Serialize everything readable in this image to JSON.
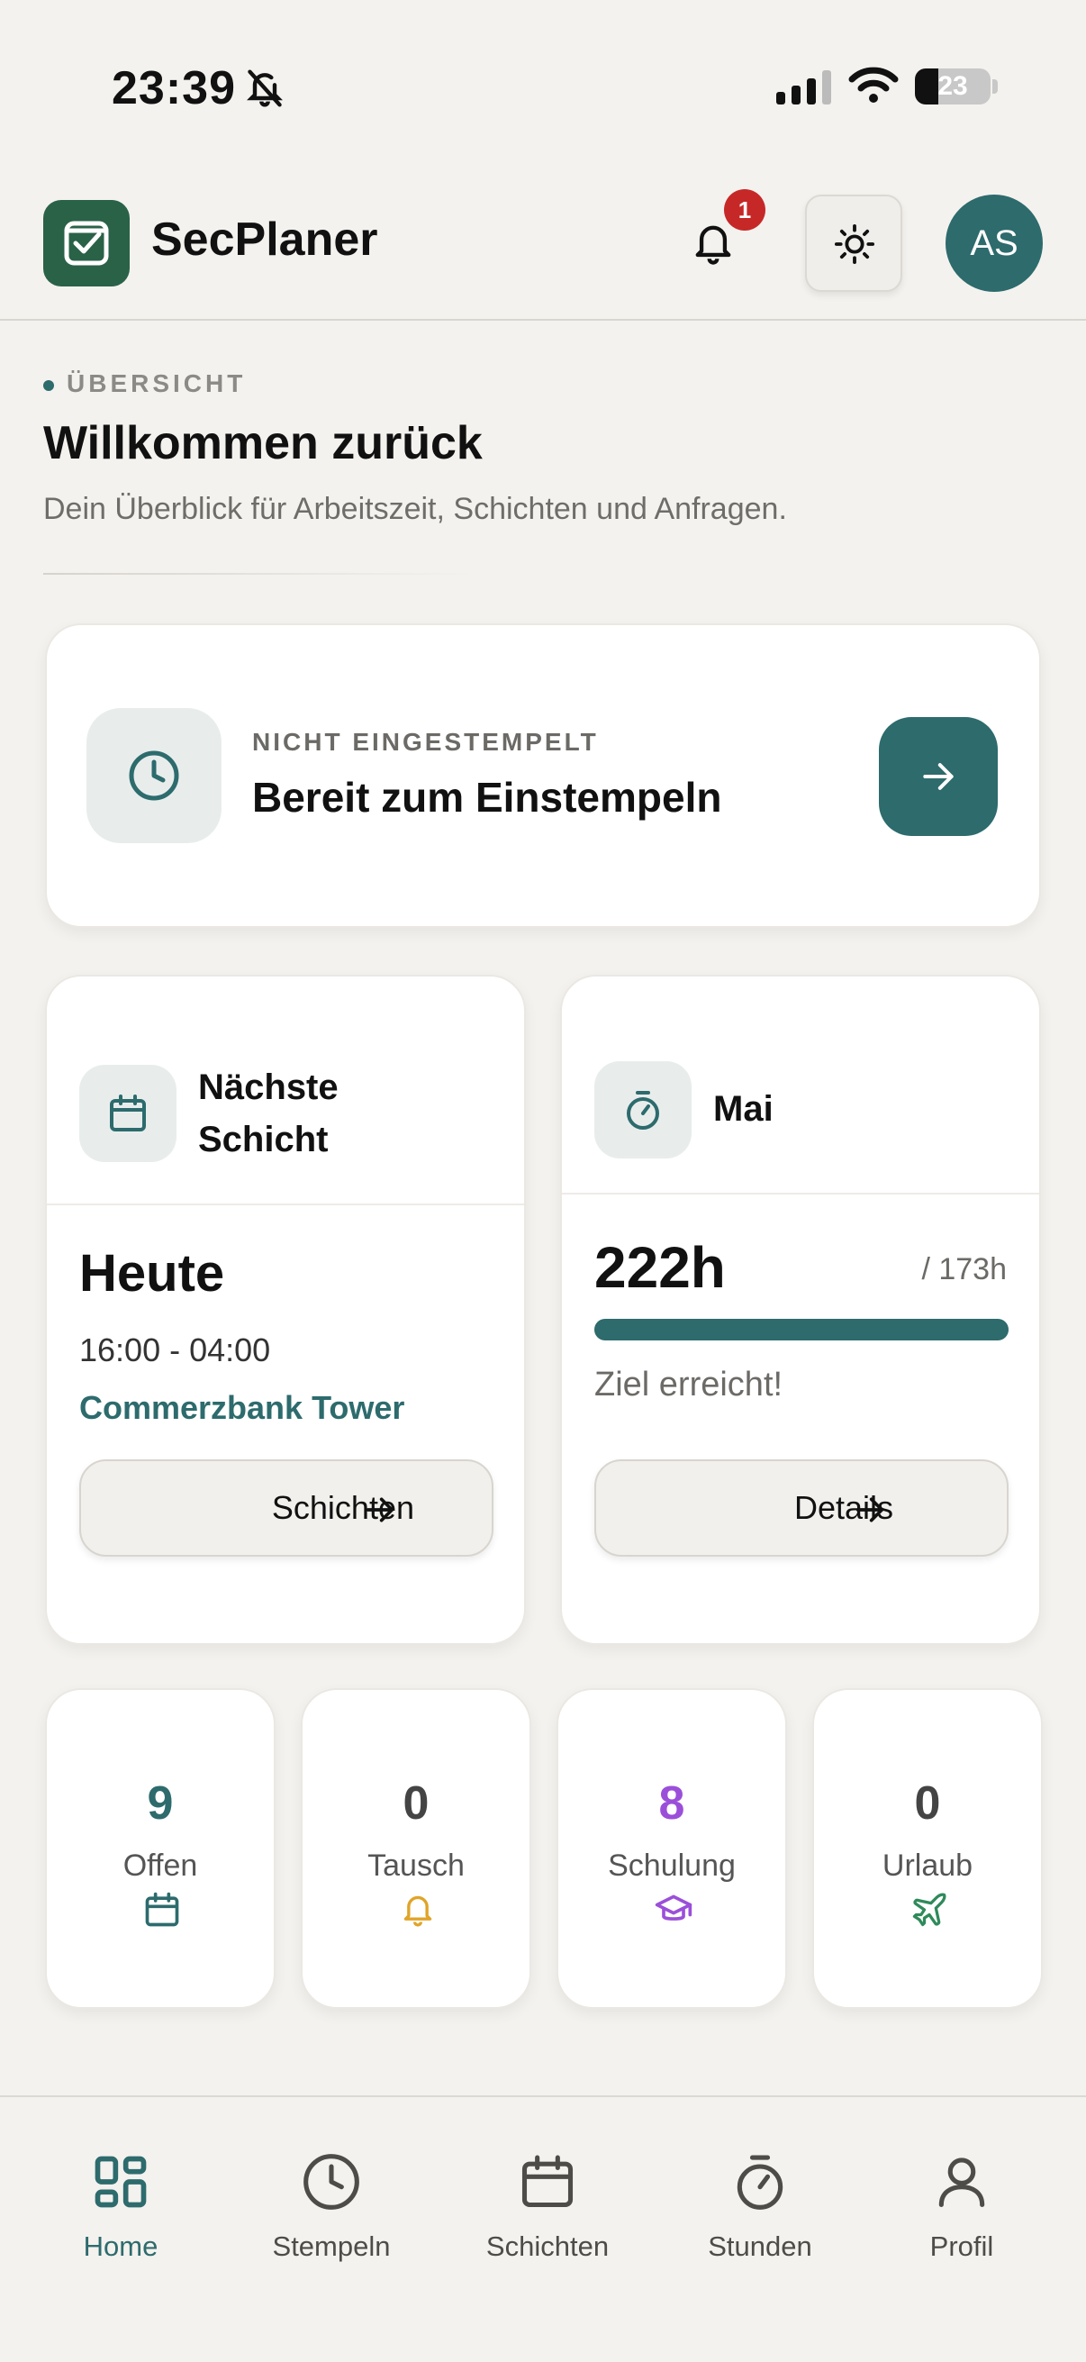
{
  "status_bar": {
    "time": "23:39",
    "battery": "23"
  },
  "header": {
    "app_name": "SecPlaner",
    "notification_count": "1",
    "avatar_initials": "AS"
  },
  "overview": {
    "kicker": "ÜBERSICHT",
    "title": "Willkommen zurück",
    "subtitle": "Dein Überblick für Arbeitszeit, Schichten und Anfragen."
  },
  "clock_in": {
    "status": "NICHT EINGESTEMPELT",
    "title": "Bereit zum Einstempeln"
  },
  "next_shift": {
    "title_line1": "Nächste",
    "title_line2": "Schicht",
    "day": "Heute",
    "time": "16:00 - 04:00",
    "location": "Commerzbank Tower",
    "button_label": "Schichten"
  },
  "hours": {
    "title": "Mai",
    "value": "222h",
    "goal": "/ 173h",
    "progress_fraction": 1.0,
    "status_text": "Ziel erreicht!",
    "button_label": "Details"
  },
  "mini_stats": [
    {
      "value": "9",
      "label": "Offen",
      "color": "#2d6b6d",
      "icon": "calendar-icon"
    },
    {
      "value": "0",
      "label": "Tausch",
      "color": "#444444",
      "icon": "bell-icon"
    },
    {
      "value": "8",
      "label": "Schulung",
      "color": "#9b4fd9",
      "icon": "graduation-cap-icon"
    },
    {
      "value": "0",
      "label": "Urlaub",
      "color": "#444444",
      "icon": "plane-icon"
    }
  ],
  "nav": {
    "items": [
      {
        "label": "Home",
        "icon": "grid-icon",
        "active": true
      },
      {
        "label": "Stempeln",
        "icon": "clock-icon"
      },
      {
        "label": "Schichten",
        "icon": "calendar-icon"
      },
      {
        "label": "Stunden",
        "icon": "stopwatch-icon"
      },
      {
        "label": "Profil",
        "icon": "user-icon"
      }
    ]
  },
  "colors": {
    "accent": "#2d6b6d",
    "brand": "#2a6248",
    "badge": "#c62828",
    "background": "#f4f2ee"
  }
}
